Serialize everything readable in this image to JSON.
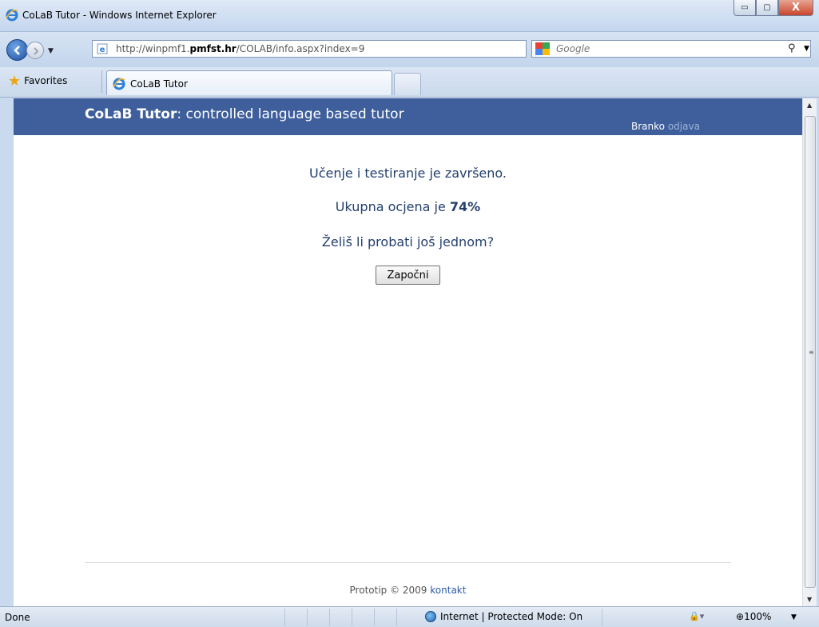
{
  "window": {
    "title": "CoLaB Tutor - Windows Internet Explorer",
    "buttons": {
      "minimize": "▭",
      "maximize": "▢",
      "close": "X"
    }
  },
  "nav": {
    "address": "http://winpmf1.",
    "address_domain": "pmfst.hr",
    "address_path": "/COLAB/info.aspx?index=9",
    "search_placeholder": "Google"
  },
  "favorites": {
    "label": "Favorites",
    "tab_title": "CoLaB Tutor"
  },
  "page": {
    "site_title_bold": "CoLaB Tutor",
    "site_title_rest": ": controlled language based tutor",
    "user": "Branko",
    "logout": "odjava",
    "message1": "Učenje i testiranje je završeno.",
    "score_prefix": "Ukupna ocjena je ",
    "score_value": "74%",
    "message3": "Želiš li probati još jednom?",
    "start_button": "Započni",
    "footer_text": "Prototip © 2009 ",
    "footer_link": "kontakt"
  },
  "status": {
    "text": "Done",
    "zone": "Internet | Protected Mode: On",
    "zoom": "100%"
  },
  "colors": {
    "header": "#3e5f9c",
    "content_text": "#233f6d",
    "link": "#2c5ba8"
  }
}
